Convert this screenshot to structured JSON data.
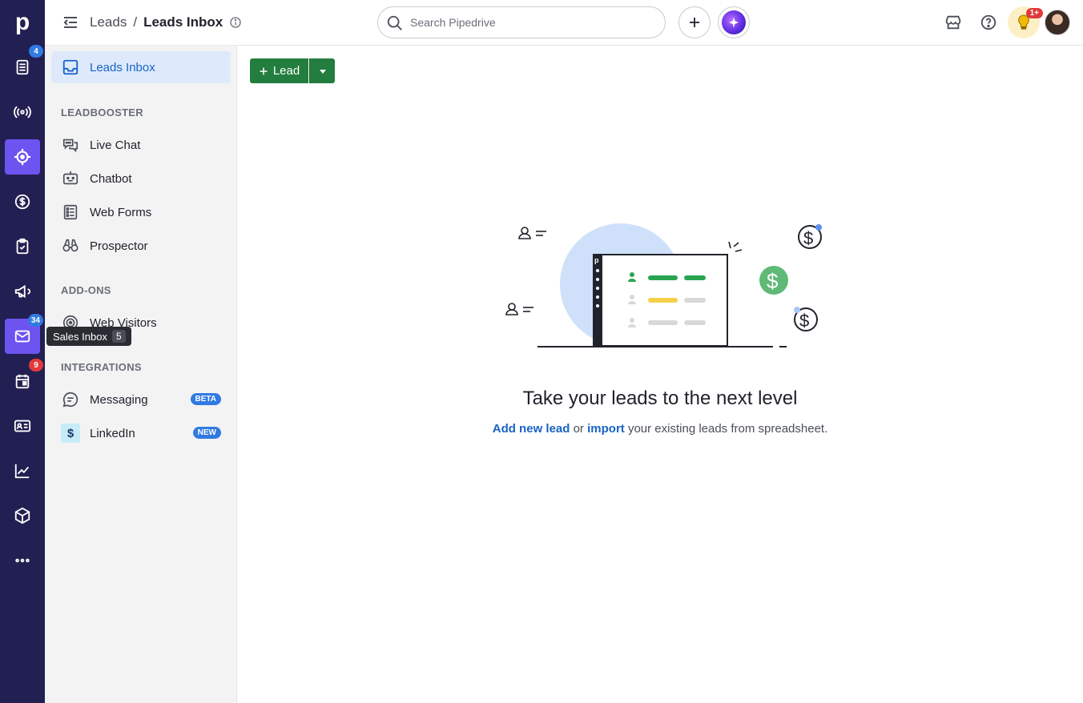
{
  "rail": {
    "logo": "p",
    "badges": {
      "leads": "4",
      "mail": "34",
      "activities": "9"
    }
  },
  "tooltip": {
    "label": "Sales Inbox",
    "shortcut": "5"
  },
  "topbar": {
    "breadcrumb_parent": "Leads",
    "breadcrumb_sep": "/",
    "breadcrumb_current": "Leads Inbox",
    "search_placeholder": "Search Pipedrive",
    "tips_badge": "1+"
  },
  "sidebar": {
    "active_item": "Leads Inbox",
    "sections": {
      "leadbooster": "LEADBOOSTER",
      "addons": "ADD-ONS",
      "integrations": "INTEGRATIONS"
    },
    "items": {
      "live_chat": "Live Chat",
      "chatbot": "Chatbot",
      "web_forms": "Web Forms",
      "prospector": "Prospector",
      "web_visitors": "Web Visitors",
      "messaging": "Messaging",
      "linkedin": "LinkedIn"
    },
    "pills": {
      "messaging": "BETA",
      "linkedin": "NEW"
    }
  },
  "toolbar": {
    "add_lead": "Lead"
  },
  "empty_state": {
    "title": "Take your leads to the next level",
    "link_add": "Add new lead",
    "text_or": " or ",
    "link_import": "import",
    "text_rest": " your existing leads from spreadsheet."
  },
  "colors": {
    "rail": "#221f52",
    "active_rail": "#6d53f0",
    "primary_green": "#237d3f",
    "link": "#1863c5"
  }
}
